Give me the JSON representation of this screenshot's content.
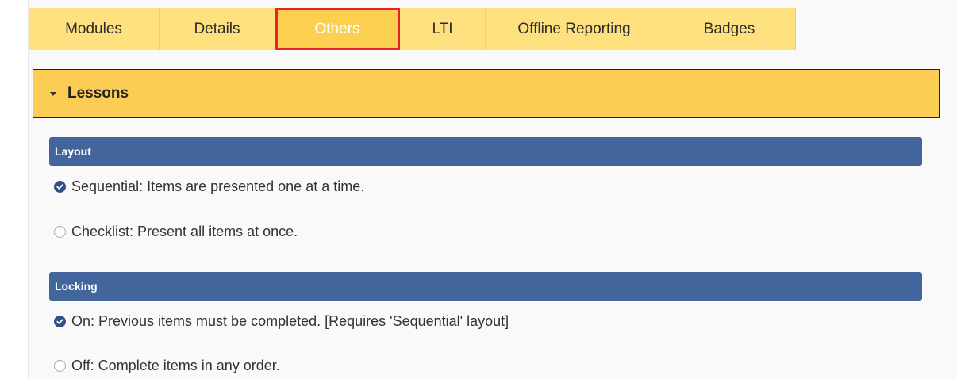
{
  "tabs": [
    {
      "label": "Modules",
      "active": false
    },
    {
      "label": "Details",
      "active": false
    },
    {
      "label": "Others",
      "active": true
    },
    {
      "label": "LTI",
      "active": false
    },
    {
      "label": "Offline Reporting",
      "active": false
    },
    {
      "label": "Badges",
      "active": false
    }
  ],
  "accordion": {
    "title": "Lessons",
    "expanded": true
  },
  "sections": [
    {
      "header": "Layout",
      "options": [
        {
          "label": "Sequential: Items are presented one at a time.",
          "selected": true
        },
        {
          "label": "Checklist: Present all items at once.",
          "selected": false
        }
      ]
    },
    {
      "header": "Locking",
      "options": [
        {
          "label": "On: Previous items must be completed. [Requires 'Sequential' layout]",
          "selected": true
        },
        {
          "label": "Off: Complete items in any order.",
          "selected": false
        }
      ]
    }
  ],
  "colors": {
    "tab_bg": "#fee17e",
    "tab_active_bg": "#fccf50",
    "active_highlight": "#e8232a",
    "accordion_bg": "#fccd55",
    "section_bar": "#42659c",
    "radio_checked": "#2f4f86"
  },
  "icons": {
    "accordion_toggle": "caret-down-icon",
    "radio_checked": "check-circle-icon",
    "radio_unchecked": "empty-circle-icon"
  }
}
